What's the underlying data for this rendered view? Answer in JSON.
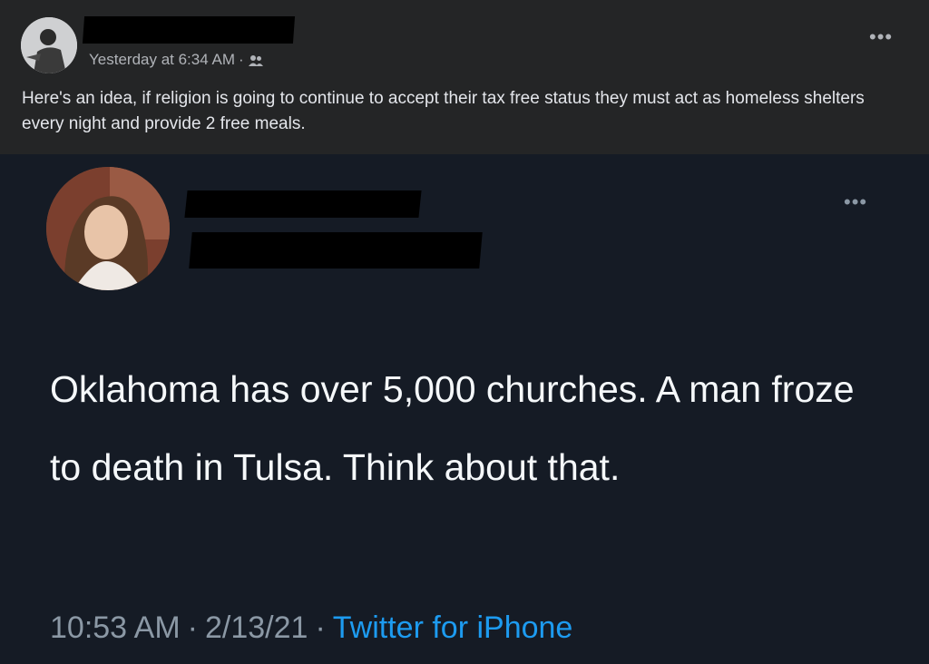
{
  "post": {
    "timestamp": "Yesterday at 6:34 AM",
    "separator": "·",
    "audience_icon": "friends-icon",
    "more_label": "•••",
    "caption": "Here's an idea, if religion is going to continue to accept their tax free status they must act as homeless shelters every night and provide 2 free meals."
  },
  "tweet": {
    "more_label": "•••",
    "text": "Oklahoma has over 5,000 churches. A man froze to death in Tulsa. Think about that.",
    "time": "10:53 AM",
    "sep1": "·",
    "date": "2/13/21",
    "sep2": "·",
    "source": "Twitter for iPhone"
  },
  "colors": {
    "post_bg": "#242526",
    "tweet_bg": "#151b25",
    "link_blue": "#1d9bf0",
    "muted_text": "#8b98a5"
  }
}
